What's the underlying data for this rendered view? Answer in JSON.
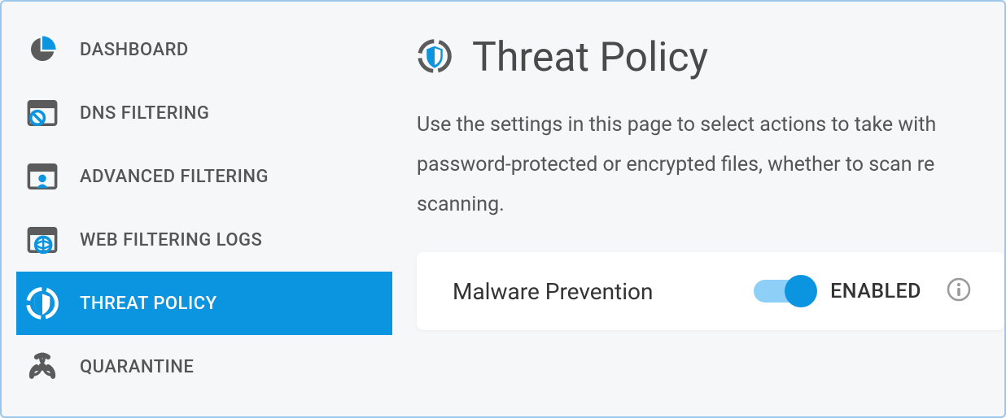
{
  "sidebar": {
    "items": [
      {
        "label": "DASHBOARD"
      },
      {
        "label": "DNS FILTERING"
      },
      {
        "label": "ADVANCED FILTERING"
      },
      {
        "label": "WEB FILTERING LOGS"
      },
      {
        "label": "THREAT POLICY"
      },
      {
        "label": "QUARANTINE"
      }
    ]
  },
  "page": {
    "title": "Threat Policy",
    "description": "Use the settings in this page to select actions to take with password-protected or encrypted files, whether to scan re scanning."
  },
  "card": {
    "title": "Malware Prevention",
    "toggle_state": "ENABLED"
  },
  "colors": {
    "accent": "#0b94e0",
    "gray": "#5b5b5b"
  }
}
